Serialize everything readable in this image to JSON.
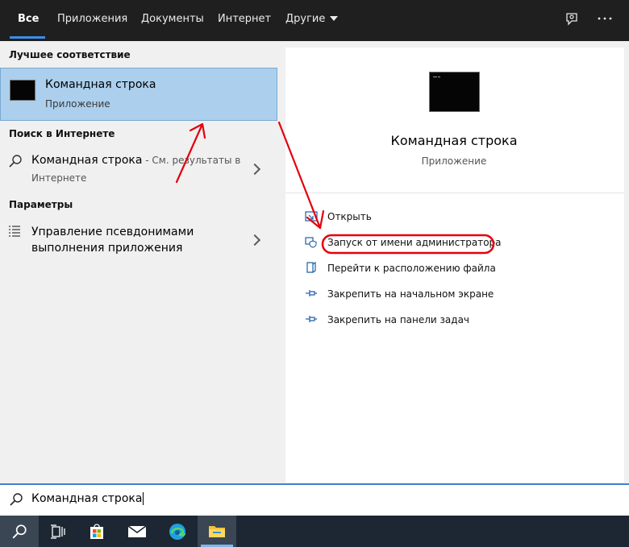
{
  "tabs": {
    "all": "Все",
    "apps": "Приложения",
    "documents": "Документы",
    "internet": "Интернет",
    "other": "Другие"
  },
  "left": {
    "best_match_header": "Лучшее соответствие",
    "best_match": {
      "title": "Командная строка",
      "subtitle": "Приложение"
    },
    "web_header": "Поиск в Интернете",
    "web_result": {
      "title": "Командная строка",
      "suffix": " - См. результаты в",
      "line2": "Интернете"
    },
    "settings_header": "Параметры",
    "settings_result": {
      "line1": "Управление псевдонимами",
      "line2": "выполнения приложения"
    }
  },
  "preview": {
    "title": "Командная строка",
    "subtitle": "Приложение",
    "actions": [
      "Открыть",
      "Запуск от имени администратора",
      "Перейти к расположению файла",
      "Закрепить на начальном экране",
      "Закрепить на панели задач"
    ]
  },
  "search": {
    "value": "Командная строка"
  },
  "colors": {
    "accent": "#3b8ee8",
    "highlight": "#abcfed",
    "annotation": "#e3000b",
    "topbar": "#1f1f1f",
    "taskbar": "#1c2733"
  }
}
